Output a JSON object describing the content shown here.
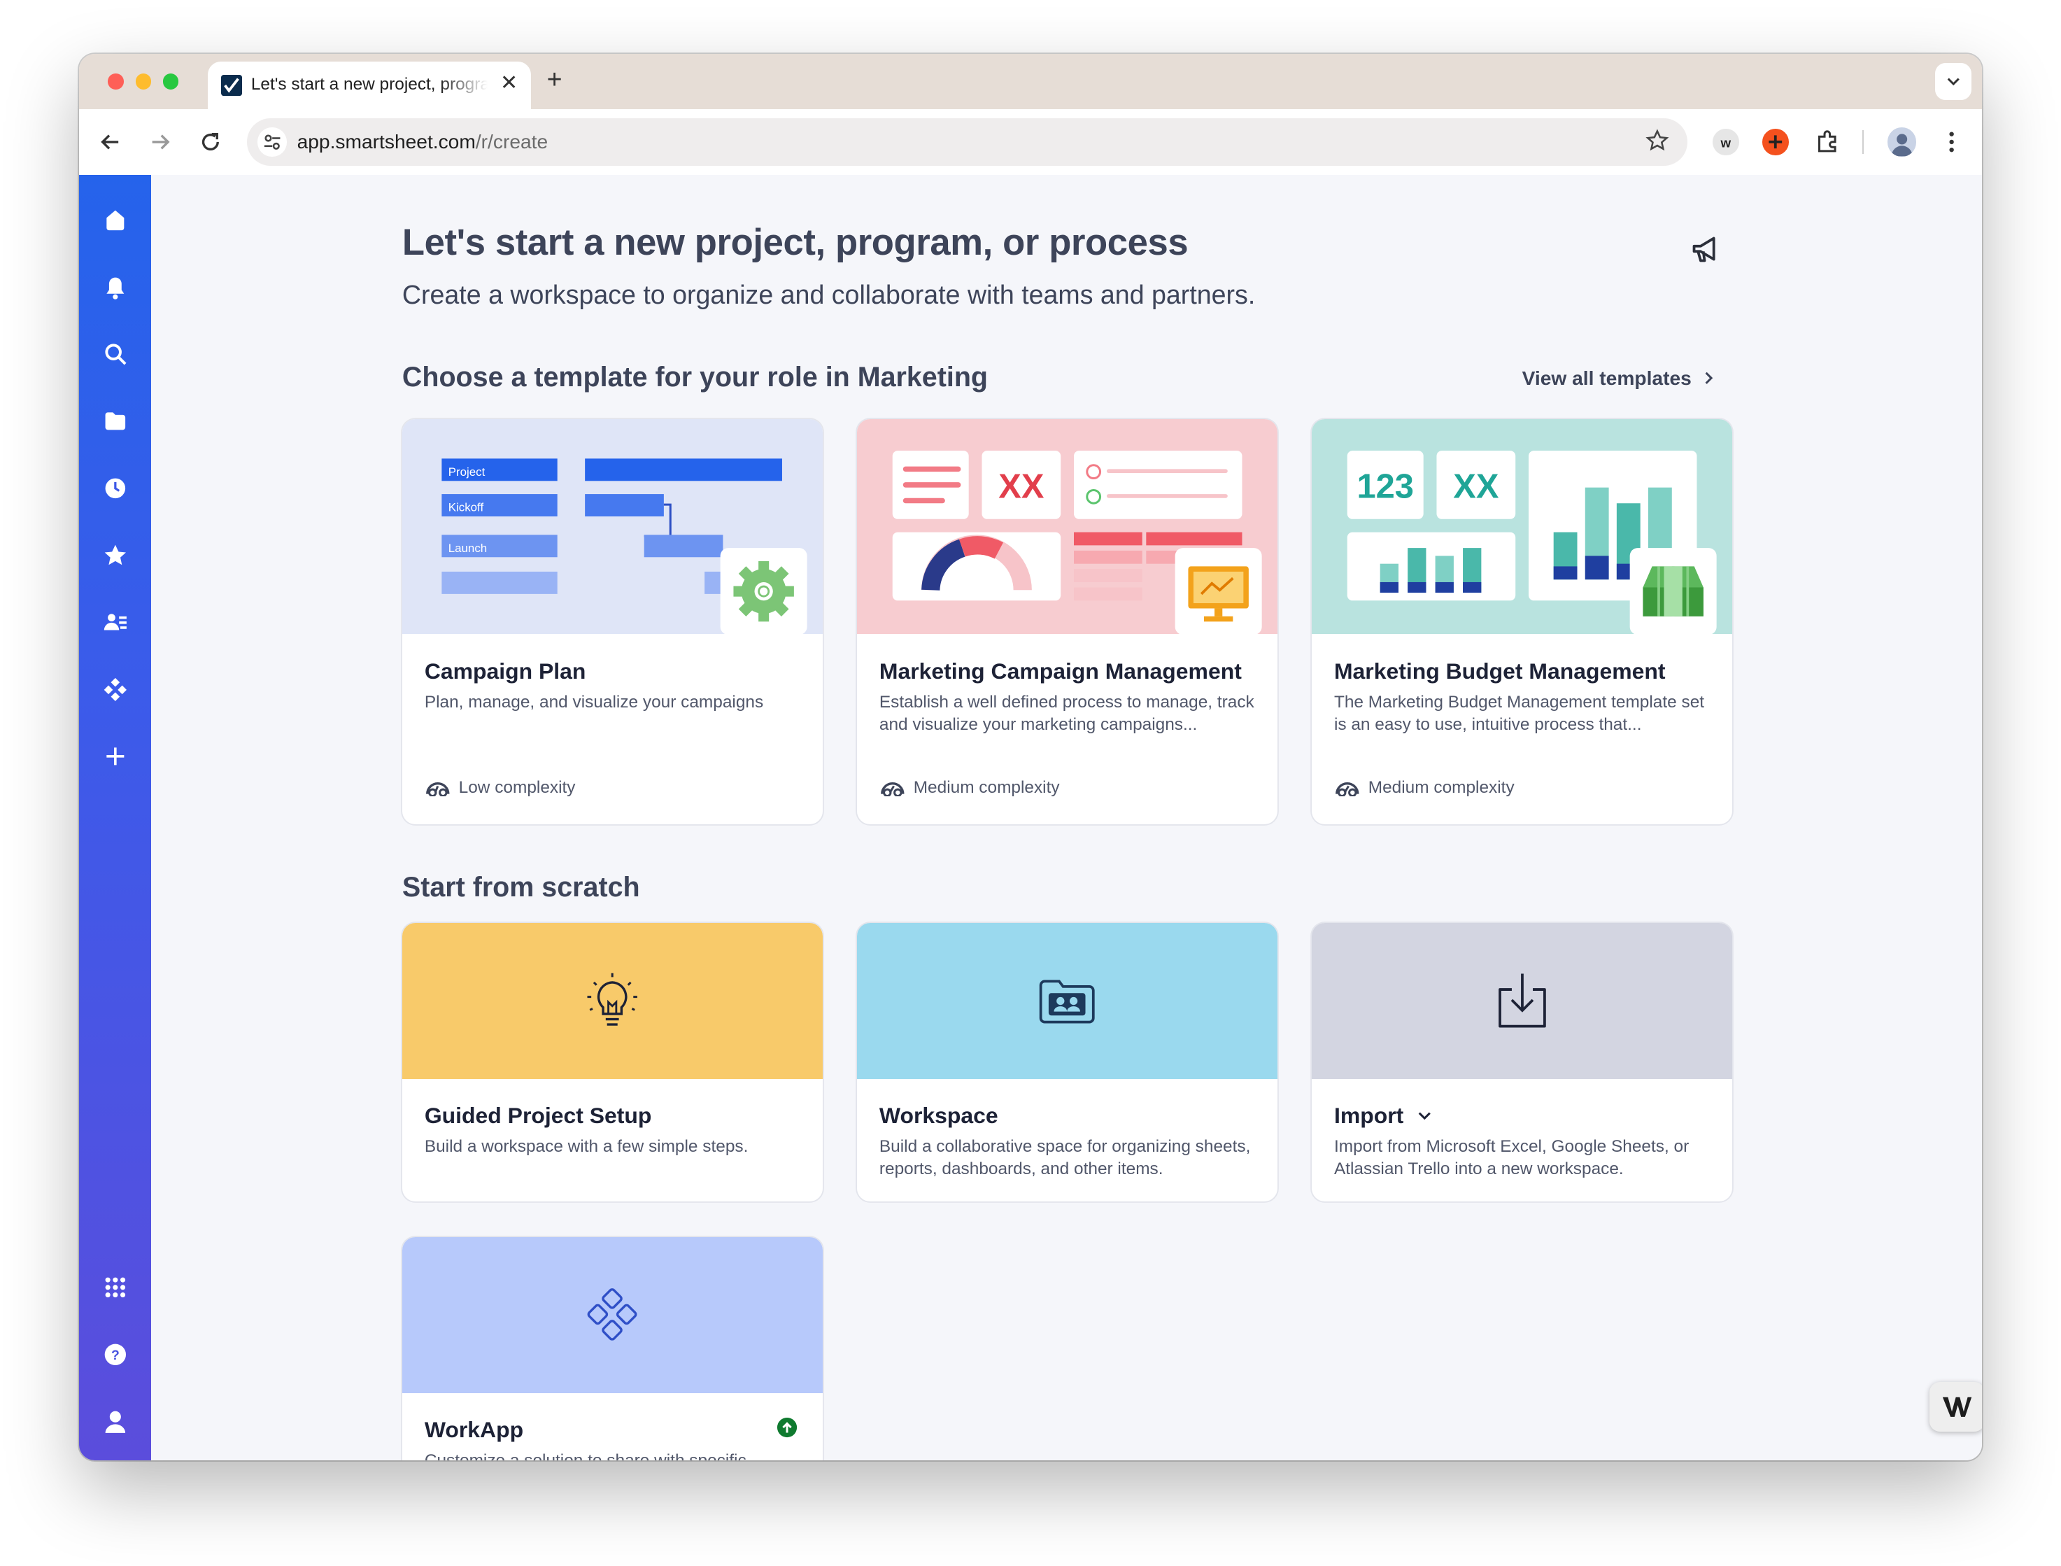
{
  "browser": {
    "tab_title": "Let's start a new project, program, or process",
    "tab_close": "✕",
    "new_tab": "+",
    "url_host": "app.smartsheet.com",
    "url_path": "/r/create"
  },
  "page": {
    "title": "Let's start a new project, program, or process",
    "subtitle": "Create a workspace to organize and collaborate with teams and partners."
  },
  "templates": {
    "section_title": "Choose a template for your role in Marketing",
    "view_all": "View all templates",
    "cards": [
      {
        "title": "Campaign Plan",
        "description": "Plan, manage, and visualize your campaigns",
        "complexity": "Low complexity",
        "art_labels": [
          "Project",
          "Kickoff",
          "Launch"
        ],
        "colors": {
          "bg": "#dfe5f7"
        }
      },
      {
        "title": "Marketing Campaign Management",
        "description": "Establish a well defined process to manage, track and visualize your marketing campaigns...",
        "complexity": "Medium complexity",
        "art_labels": [
          "XX"
        ],
        "colors": {
          "bg": "#f7ccd0"
        }
      },
      {
        "title": "Marketing Budget Management",
        "description": "The Marketing Budget Management template set is an easy to use, intuitive process that...",
        "complexity": "Medium complexity",
        "art_labels": [
          "123",
          "XX"
        ],
        "colors": {
          "bg": "#b9e3df"
        }
      }
    ]
  },
  "scratch": {
    "section_title": "Start from scratch",
    "cards": [
      {
        "title": "Guided Project Setup",
        "description": "Build a workspace with a few simple steps.",
        "icon": "lightbulb-icon",
        "color": "#f8ca6a"
      },
      {
        "title": "Workspace",
        "description": "Build a collaborative space for organizing sheets, reports, dashboards, and other items.",
        "icon": "workspace-folder-icon",
        "color": "#9ad9ee"
      },
      {
        "title": "Import",
        "description": "Import from Microsoft Excel, Google Sheets, or Atlassian Trello into a new workspace.",
        "icon": "import-icon",
        "color": "#d3d5e1"
      },
      {
        "title": "WorkApp",
        "description": "Customize a solution to share with specific",
        "icon": "workapp-icon",
        "color": "#b7c9fb"
      }
    ]
  },
  "sidebar": {
    "items": [
      "home-icon",
      "notifications-icon",
      "search-icon",
      "browse-icon",
      "recents-icon",
      "favorites-icon",
      "contacts-icon",
      "workapps-icon",
      "create-icon"
    ],
    "bottom": [
      "launcher-icon",
      "help-icon",
      "account-icon"
    ]
  }
}
